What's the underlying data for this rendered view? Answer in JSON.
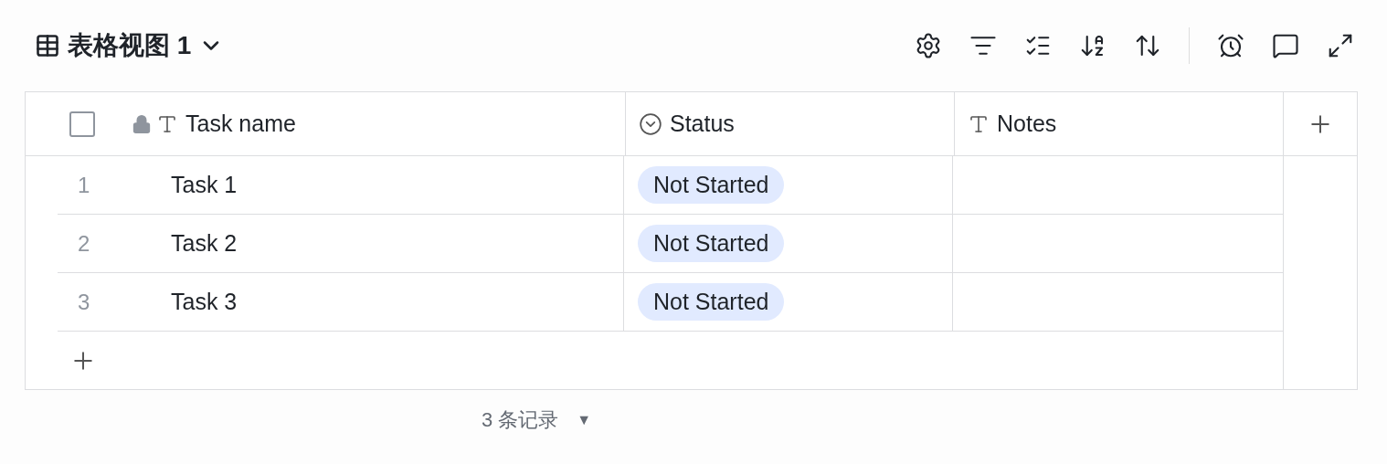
{
  "view": {
    "title": "表格视图 1"
  },
  "select_all": {
    "checked": false
  },
  "columns": [
    {
      "name": "Task name",
      "kind": "text"
    },
    {
      "name": "Status",
      "kind": "select"
    },
    {
      "name": "Notes",
      "kind": "text"
    }
  ],
  "rows": [
    {
      "index": "1",
      "task": "Task 1",
      "status": "Not Started"
    },
    {
      "index": "2",
      "task": "Task 2",
      "status": "Not Started"
    },
    {
      "index": "3",
      "task": "Task 3",
      "status": "Not Started"
    }
  ],
  "footer": {
    "count": "3 条记录",
    "caret": "▼"
  }
}
